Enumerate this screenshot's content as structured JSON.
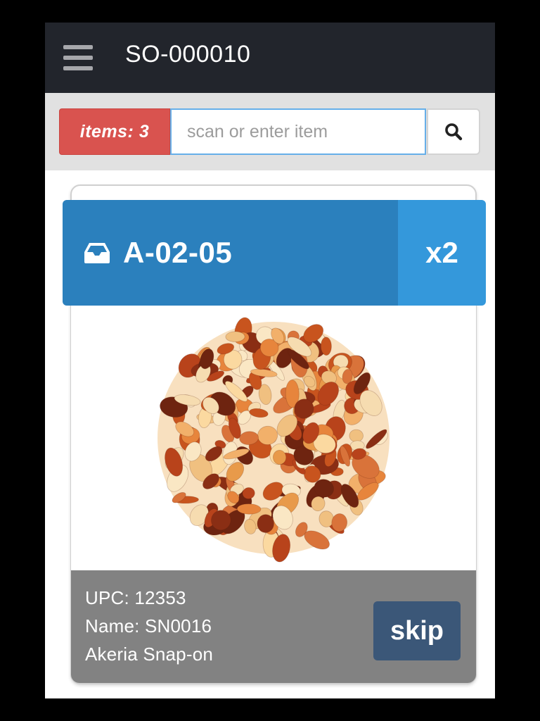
{
  "header": {
    "order_id": "SO-000010",
    "menu_icon": "hamburger-menu-icon"
  },
  "scan": {
    "items_badge": "items: 3",
    "input_value": "",
    "input_placeholder": "scan or enter item",
    "search_icon": "magnifier-icon"
  },
  "pick": {
    "location_icon": "inbox-tray-icon",
    "location": "A-02-05",
    "quantity": "x2",
    "image_alt": "amber and carnelian gemstone chips",
    "upc_line": "UPC: 12353",
    "name_line": "Name: SN0016",
    "desc_line": "Akeria Snap-on",
    "skip_label": "skip"
  },
  "colors": {
    "topbar": "#22252c",
    "badge": "#d9534f",
    "location": "#2b80bd",
    "quantity": "#3498db",
    "details_panel": "#828282",
    "skip_button": "#3b5778"
  }
}
